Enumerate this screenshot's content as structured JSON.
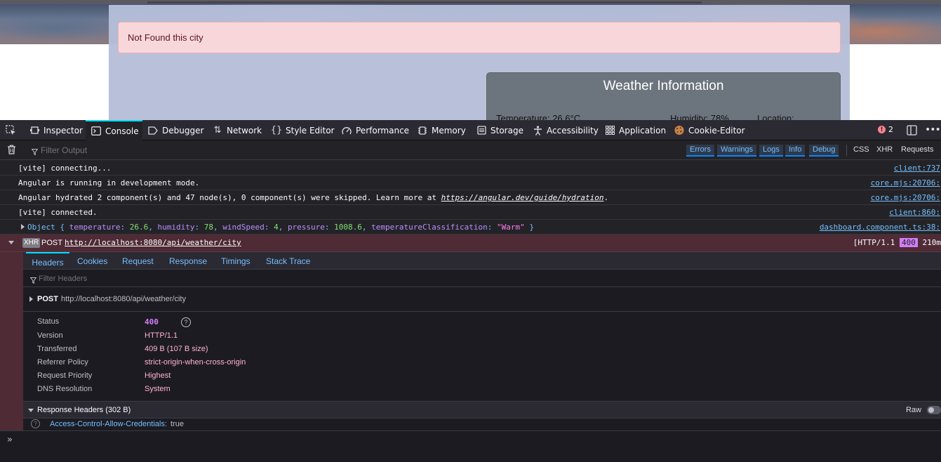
{
  "page": {
    "alert_text": "Not Found this city",
    "weather_title": "Weather Information",
    "temperature_line": "Temperature: 26.6°C",
    "humidity_line": "Humidity: 78%",
    "location_line": "Location:"
  },
  "devtools": {
    "tabs": [
      {
        "label": "Inspector",
        "icon": "inspector-icon"
      },
      {
        "label": "Console",
        "icon": "console-icon",
        "active": true
      },
      {
        "label": "Debugger",
        "icon": "debugger-icon"
      },
      {
        "label": "Network",
        "icon": "network-icon"
      },
      {
        "label": "Style Editor",
        "icon": "braces-icon"
      },
      {
        "label": "Performance",
        "icon": "gauge-icon"
      },
      {
        "label": "Memory",
        "icon": "chip-icon"
      },
      {
        "label": "Storage",
        "icon": "storage-icon"
      },
      {
        "label": "Accessibility",
        "icon": "accessibility-icon"
      },
      {
        "label": "Application",
        "icon": "grid-icon"
      },
      {
        "label": "Cookie-Editor",
        "icon": "cookie-icon"
      }
    ],
    "error_count": "2",
    "filter_placeholder": "Filter Output",
    "levels": [
      "Errors",
      "Warnings",
      "Logs",
      "Info",
      "Debug"
    ],
    "extra_filters": [
      "CSS",
      "XHR",
      "Requests"
    ],
    "messages": [
      {
        "text": "[vite] connecting...",
        "source": "client:737"
      },
      {
        "text": "Angular is running in development mode.",
        "source": "core.mjs:20706:"
      },
      {
        "text_before": "Angular hydrated 2 component(s) and 47 node(s), 0 component(s) were skipped. Learn more at ",
        "link": "https://angular.dev/guide/hydration",
        "text_after": ".",
        "source": "core.mjs:20706:"
      },
      {
        "text": "[vite] connected.",
        "source": "client:860:"
      },
      {
        "source": "dashboard.component.ts:38:"
      }
    ],
    "object_log": {
      "prefix": "Object { ",
      "temperature_key": "temperature",
      "temperature_val": "26.6",
      "humidity_key": "humidity",
      "humidity_val": "78",
      "windSpeed_key": "windSpeed",
      "windSpeed_val": "4",
      "pressure_key": "pressure",
      "pressure_val": "1008.6",
      "class_key": "temperatureClassification",
      "class_val": "\"Warm\"",
      "suffix": " }"
    },
    "xhr": {
      "badge": "XHR",
      "method": "POST",
      "url": "http://localhost:8080/api/weather/city",
      "proto_prefix": "[HTTP/1.1",
      "status": "400",
      "time": "210m"
    },
    "net_tabs": [
      "Headers",
      "Cookies",
      "Request",
      "Response",
      "Timings",
      "Stack Trace"
    ],
    "filter_headers_placeholder": "Filter Headers",
    "request_summary": {
      "method": "POST",
      "url": "http://localhost:8080/api/weather/city"
    },
    "details": [
      {
        "label": "Status",
        "value": "400"
      },
      {
        "label": "Version",
        "value": "HTTP/1.1"
      },
      {
        "label": "Transferred",
        "value": "409 B (107 B size)"
      },
      {
        "label": "Referrer Policy",
        "value": "strict-origin-when-cross-origin"
      },
      {
        "label": "Request Priority",
        "value": "Highest"
      },
      {
        "label": "DNS Resolution",
        "value": "System"
      }
    ],
    "response_headers_title": "Response Headers (302 B)",
    "raw_label": "Raw",
    "header_row": {
      "name": "Access-Control-Allow-Credentials:",
      "value": "true"
    },
    "prompt_symbol": "»"
  }
}
